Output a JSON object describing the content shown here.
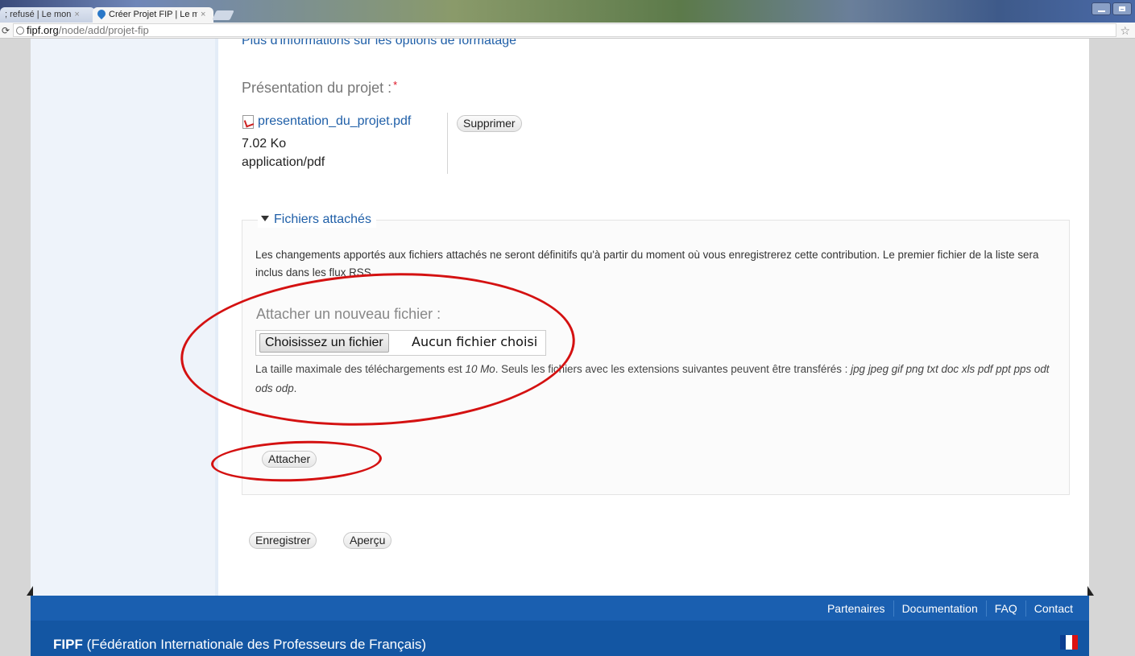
{
  "browser": {
    "tabs": [
      {
        "label": "; refusé | Le mon",
        "active": false
      },
      {
        "label": "Créer Projet FIP | Le m",
        "active": true
      }
    ],
    "url_host": "fipf.org",
    "url_path": "/node/add/projet-fip"
  },
  "form": {
    "format_link": "Plus d'informations sur les options de formatage",
    "presentation_label": "Présentation du projet :",
    "required_marker": "*",
    "file": {
      "name": "presentation_du_projet.pdf",
      "size": "7.02 Ko",
      "mime": "application/pdf"
    },
    "delete_label": "Supprimer",
    "attachments": {
      "legend": "Fichiers attachés",
      "description": "Les changements apportés aux fichiers attachés ne seront définitifs qu'à partir du moment où vous enregistrerez cette contribution. Le premier fichier de la liste sera inclus dans les flux RSS.",
      "new_file_label": "Attacher un nouveau fichier :",
      "choose_button": "Choisissez un fichier",
      "no_file": "Aucun fichier choisi",
      "help_prefix": "La taille maximale des téléchargements est ",
      "help_size": "10 Mo",
      "help_middle": ". Seuls les fichiers avec les extensions suivantes peuvent être transférés : ",
      "help_extensions": "jpg jpeg gif png txt doc xls pdf ppt pps odt ods odp",
      "help_end": ".",
      "attach_button": "Attacher"
    },
    "save_button": "Enregistrer",
    "preview_button": "Aperçu"
  },
  "footer": {
    "links": [
      "Partenaires",
      "Documentation",
      "FAQ",
      "Contact"
    ],
    "org_abbr": "FIPF",
    "org_full": "(Fédération Internationale des Professeurs de Français)"
  },
  "annotation_color": "#d41111",
  "footer_color": "#1a5fb0"
}
